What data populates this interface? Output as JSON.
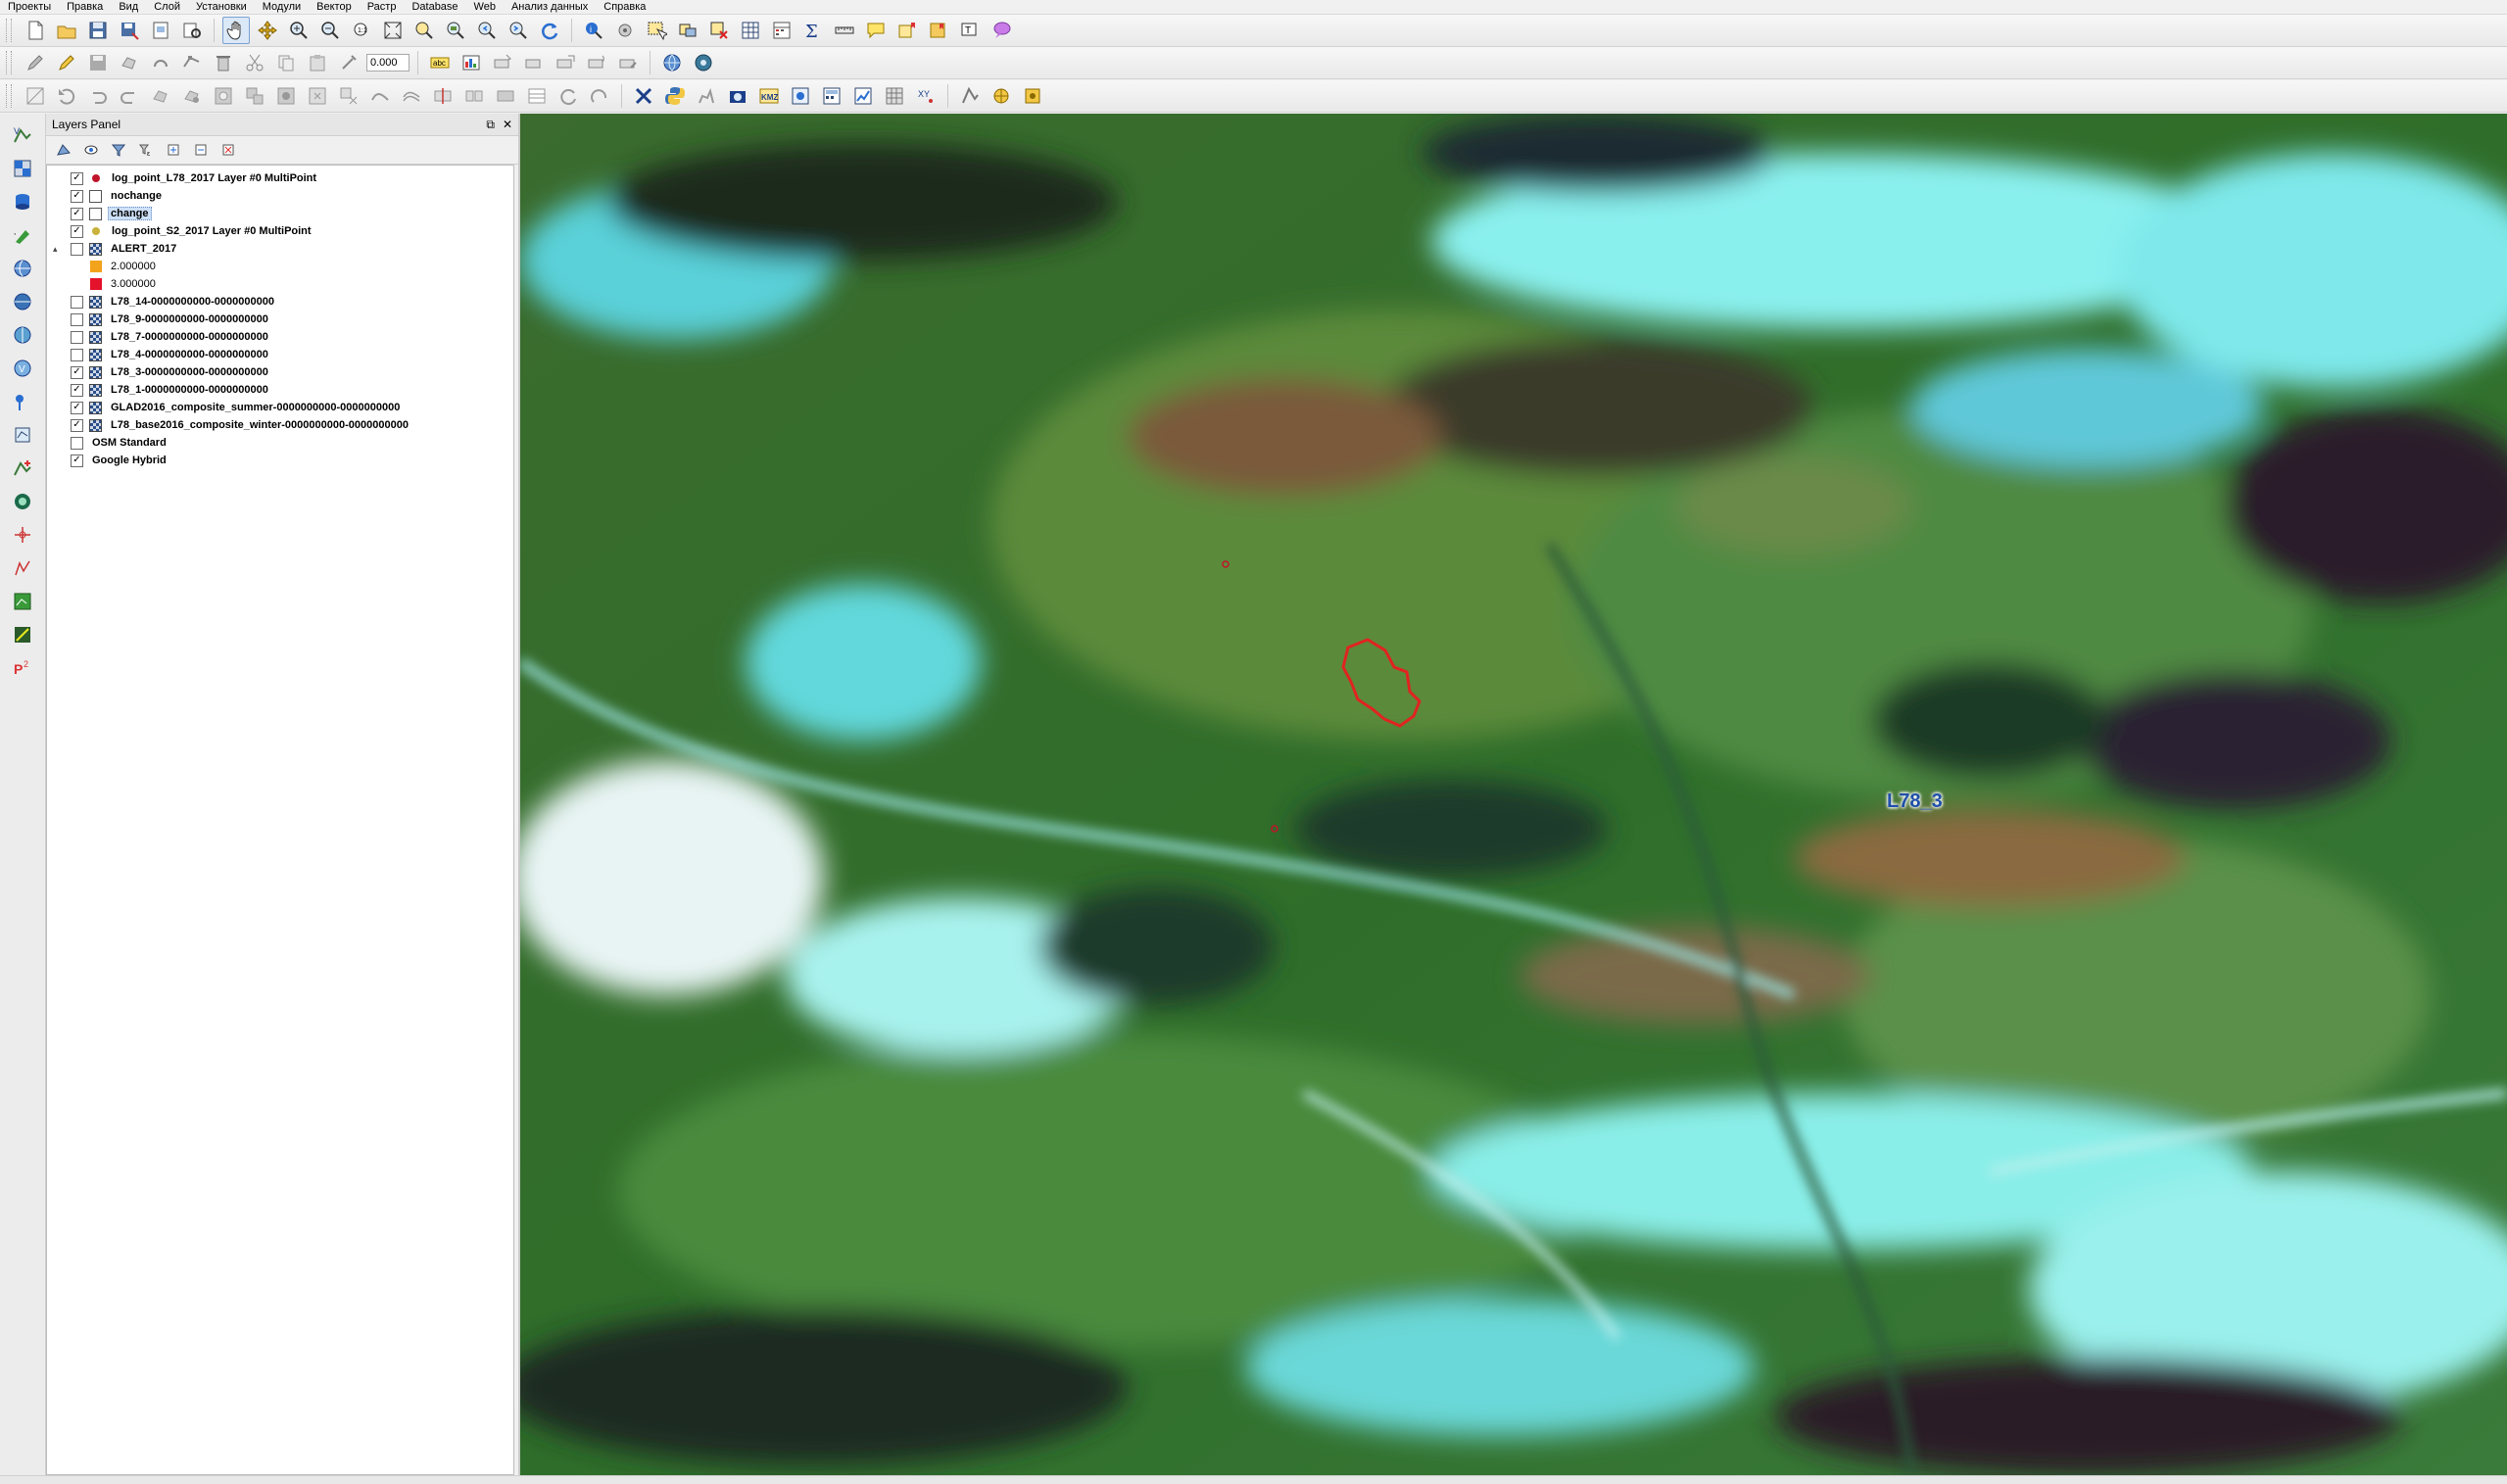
{
  "menubar": {
    "items": [
      "Проекты",
      "Правка",
      "Вид",
      "Слой",
      "Установки",
      "Модули",
      "Вектор",
      "Растр",
      "Database",
      "Web",
      "Анализ данных",
      "Справка"
    ]
  },
  "toolbar": {
    "scale_value": "0.000"
  },
  "layers_panel": {
    "title": "Layers Panel",
    "float_icon": "⧉",
    "close_icon": "✕",
    "layers": [
      {
        "label": "log_point_L78_2017 Layer #0 MultiPoint",
        "checked": "✓",
        "symbol": "dot",
        "color": "#c0142a"
      },
      {
        "label": "nochange",
        "checked": "✓",
        "symbol": "poly",
        "color": "#ffffff"
      },
      {
        "label": "change",
        "checked": "✓",
        "symbol": "poly",
        "color": "#ffffff",
        "selected": true
      },
      {
        "label": "log_point_S2_2017 Layer #0 MultiPoint",
        "checked": "✓",
        "symbol": "dot",
        "color": "#c9b23a"
      },
      {
        "label": "ALERT_2017",
        "checked": "",
        "symbol": "raster",
        "expanded": "▴"
      },
      {
        "label": "2.000000",
        "symbol": "swatch",
        "color": "#f3a21b",
        "legend": true
      },
      {
        "label": "3.000000",
        "symbol": "swatch",
        "color": "#e4122a",
        "legend": true
      },
      {
        "label": "L78_14-0000000000-0000000000",
        "checked": "",
        "symbol": "raster"
      },
      {
        "label": "L78_9-0000000000-0000000000",
        "checked": "",
        "symbol": "raster"
      },
      {
        "label": "L78_7-0000000000-0000000000",
        "checked": "",
        "symbol": "raster"
      },
      {
        "label": "L78_4-0000000000-0000000000",
        "checked": "",
        "symbol": "raster"
      },
      {
        "label": "L78_3-0000000000-0000000000",
        "checked": "✓",
        "symbol": "raster"
      },
      {
        "label": "L78_1-0000000000-0000000000",
        "checked": "✓",
        "symbol": "raster"
      },
      {
        "label": "GLAD2016_composite_summer-0000000000-0000000000",
        "checked": "✓",
        "symbol": "raster"
      },
      {
        "label": "L78_base2016_composite_winter-0000000000-0000000000",
        "checked": "✓",
        "symbol": "raster"
      },
      {
        "label": "OSM Standard",
        "checked": "",
        "symbol": "none"
      },
      {
        "label": "Google Hybrid",
        "checked": "✓",
        "symbol": "none"
      }
    ]
  },
  "map": {
    "polygon_label": "L78_3",
    "polygon_color": "#e0241f",
    "point_color": "#c0142a"
  },
  "colors": {
    "selection": "#cde0f7",
    "accent": "#1f4fa8"
  }
}
